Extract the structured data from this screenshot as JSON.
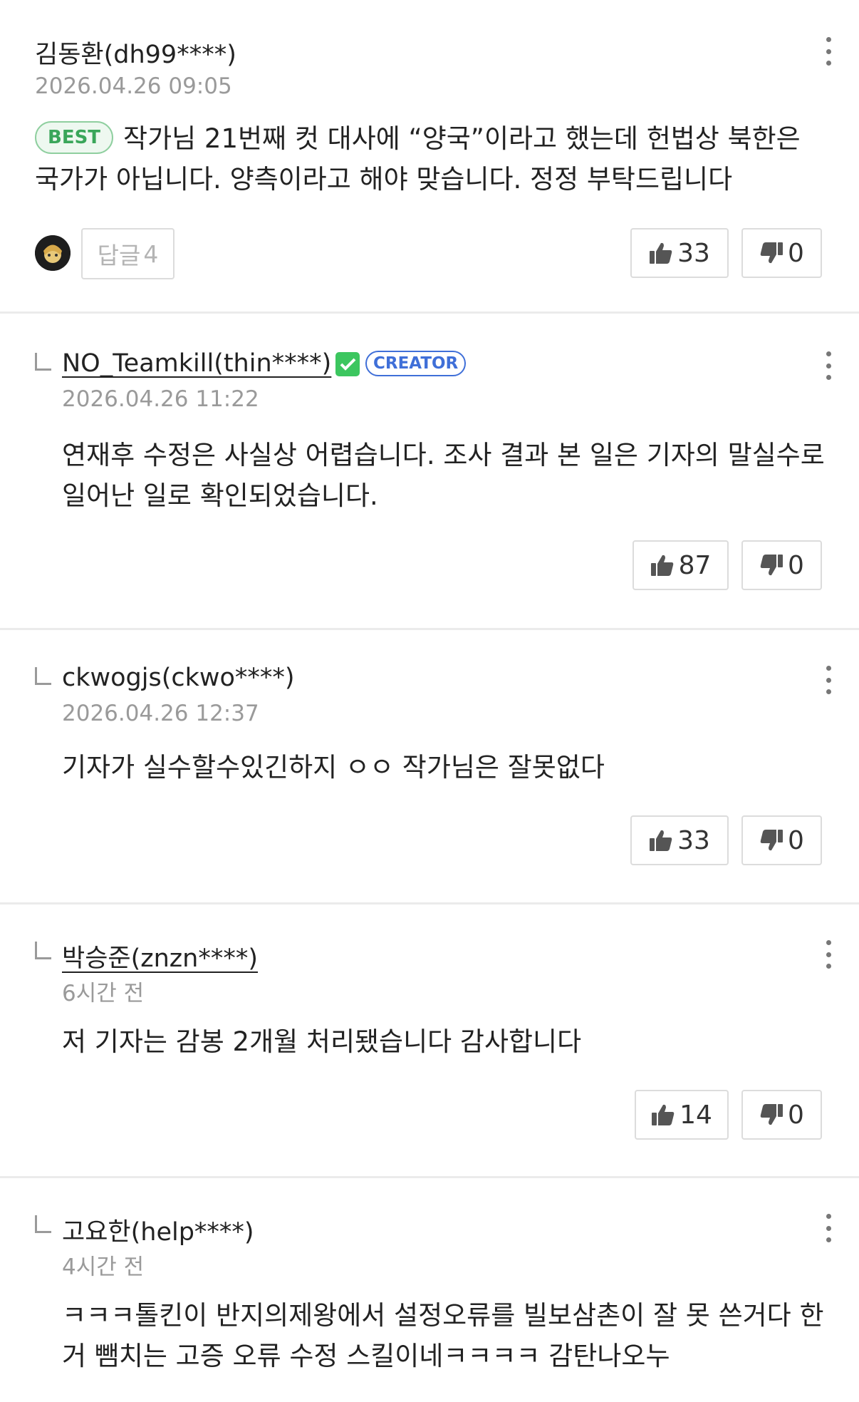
{
  "comments": [
    {
      "author": "김동환(dh99****)",
      "date": "2026.04.26 09:05",
      "badge": "BEST",
      "body": "작가님 21번째 컷 대사에 “양국”이라고 했는데 헌법상 북한은 국가가 아닙니다. 양측이라고 해야 맞습니다. 정정 부탁드립니다",
      "reply_label": "답글",
      "reply_count": "4",
      "likes": "33",
      "dislikes": "0"
    },
    {
      "author": "NO_Teamkill(thin****)",
      "badge": "CREATOR",
      "date": "2026.04.26 11:22",
      "body": "연재후 수정은 사실상 어렵습니다. 조사 결과 본 일은 기자의 말실수로 일어난 일로 확인되었습니다.",
      "likes": "87",
      "dislikes": "0"
    },
    {
      "author": "ckwogjs(ckwo****)",
      "date": "2026.04.26 12:37",
      "body": "기자가 실수할수있긴하지 ㅇㅇ 작가님은 잘못없다",
      "likes": "33",
      "dislikes": "0"
    },
    {
      "author": "박승준(znzn****)",
      "date": "6시간 전",
      "body": "저 기자는 감봉 2개월 처리됐습니다 감사합니다",
      "likes": "14",
      "dislikes": "0"
    },
    {
      "author": "고요한(help****)",
      "date": "4시간 전",
      "body": "ㅋㅋㅋ톨킨이 반지의제왕에서 설정오류를 빌보삼촌이 잘 못 쓴거다 한 거 뺌치는 고증 오류 수정 스킬이네ㅋㅋㅋㅋ 감탄나오누"
    }
  ],
  "colors": {
    "best_green": "#3aa65a",
    "creator_blue": "#3f6fd8",
    "verified_green": "#3cc65f",
    "divider": "#ebebeb"
  },
  "icons": [
    "more-vertical-icon",
    "thumbs-up-icon",
    "thumbs-down-icon",
    "reply-indent-icon",
    "verified-check-icon"
  ]
}
